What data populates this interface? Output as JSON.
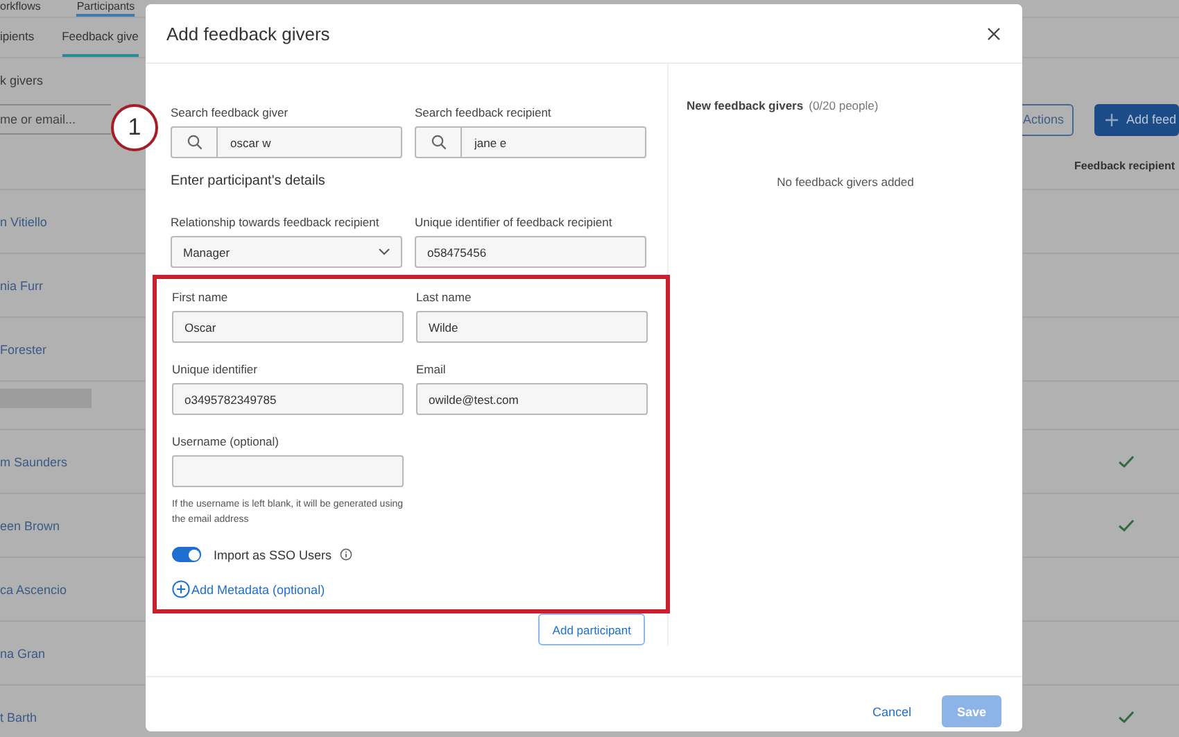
{
  "top_nav": [
    {
      "label": "orkflows",
      "selected": false
    },
    {
      "label": "Participants",
      "selected": true
    }
  ],
  "sub_tabs": [
    {
      "label": "ipients",
      "selected": false
    },
    {
      "label": "Feedback give",
      "selected": true
    }
  ],
  "list": {
    "title": "k givers",
    "search": {
      "placeholder": "me or email..."
    },
    "actions_button": "Actions",
    "add_button": "Add feed",
    "column_header": "Feedback recipient",
    "rows": [
      {
        "kind": "person",
        "name": "n Vitiello",
        "recipient": false
      },
      {
        "kind": "person",
        "name": "nia Furr",
        "recipient": false
      },
      {
        "kind": "person",
        "name": "Forester",
        "recipient": false
      },
      {
        "kind": "loading"
      },
      {
        "kind": "person",
        "name": "m Saunders",
        "recipient": true
      },
      {
        "kind": "person",
        "name": "een Brown",
        "recipient": true
      },
      {
        "kind": "person",
        "name": "ca Ascencio",
        "recipient": false
      },
      {
        "kind": "person",
        "name": "na Gran",
        "recipient": false
      },
      {
        "kind": "person",
        "name": "t Barth",
        "recipient": true
      }
    ]
  },
  "step_marker": "1",
  "modal": {
    "title": "Add feedback givers",
    "search_giver": {
      "label": "Search feedback giver",
      "value": "oscar w"
    },
    "search_recipient": {
      "label": "Search feedback recipient",
      "value": "jane e"
    },
    "section_title": "Enter participant's details",
    "relationship": {
      "label": "Relationship towards feedback recipient",
      "value": "Manager"
    },
    "recipient_id": {
      "label": "Unique identifier of feedback recipient",
      "value": "o58475456"
    },
    "highlighted_fields": [
      {
        "label": "First name",
        "value": "Oscar"
      },
      {
        "label": "Last name",
        "value": "Wilde"
      },
      {
        "label": "Unique identifier",
        "value": "o3495782349785"
      },
      {
        "label": "Email",
        "value": "owilde@test.com"
      }
    ],
    "username": {
      "label": "Username (optional)",
      "hint": "If the username is left blank, it will be generated using the email address"
    },
    "sso_toggle": {
      "label": "Import as SSO Users",
      "on": true
    },
    "add_metadata_link": "Add Metadata (optional)",
    "add_participant_button": "Add participant",
    "new_givers": {
      "title": "New feedback givers",
      "count": "(0/20 people)",
      "empty_text": "No feedback givers added"
    },
    "cancel_button": "Cancel",
    "save_button": {
      "label": "Save",
      "disabled": true
    }
  }
}
